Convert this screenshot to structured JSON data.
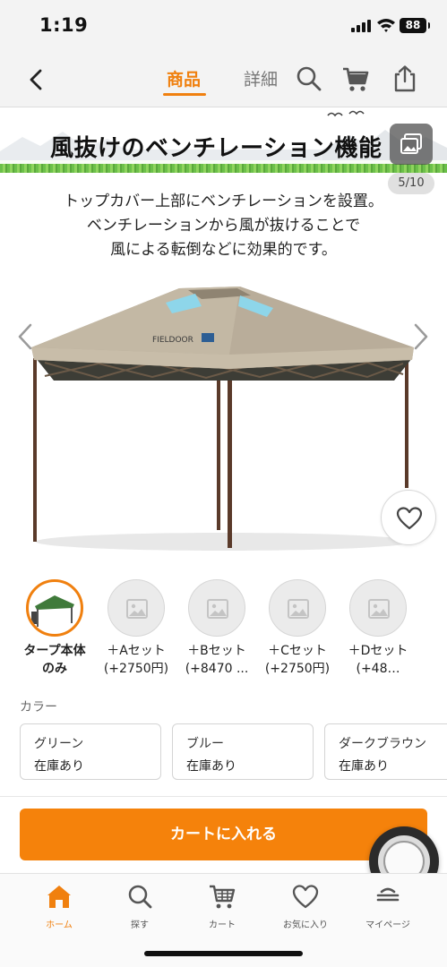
{
  "status_bar": {
    "time": "1:19",
    "battery": "88"
  },
  "nav": {
    "tab_product": "商品",
    "tab_detail": "詳細"
  },
  "gallery": {
    "banner_title": "風抜けのベンチレーション機能",
    "counter": "5/10",
    "description": [
      "トップカバー上部にベンチレーションを設置。",
      "ベンチレーションから風が抜けることで",
      "風による転倒などに効果的です。"
    ],
    "tent_logo": "FIELDOOR"
  },
  "variants": [
    {
      "label_line1": "タープ本体",
      "label_line2": "のみ",
      "selected": true
    },
    {
      "label_line1": "＋Aセット",
      "label_line2": "(+2750円)",
      "selected": false
    },
    {
      "label_line1": "＋Bセット",
      "label_line2": "(+8470 ...",
      "selected": false
    },
    {
      "label_line1": "＋Cセット",
      "label_line2": "(+2750円)",
      "selected": false
    },
    {
      "label_line1": "＋Dセット",
      "label_line2": "(+48…",
      "selected": false
    }
  ],
  "color_section": {
    "label": "カラー",
    "options": [
      {
        "name": "グリーン",
        "stock": "在庫あり"
      },
      {
        "name": "ブルー",
        "stock": "在庫あり"
      },
      {
        "name": "ダークブラウン",
        "stock": "在庫あり"
      }
    ]
  },
  "cart_button": "カートに入れる",
  "tab_bar": [
    {
      "label": "ホーム",
      "icon": "home-icon",
      "active": true
    },
    {
      "label": "探す",
      "icon": "search-icon",
      "active": false
    },
    {
      "label": "カート",
      "icon": "cart-icon",
      "active": false
    },
    {
      "label": "お気に入り",
      "icon": "heart-icon",
      "active": false
    },
    {
      "label": "マイページ",
      "icon": "user-icon",
      "active": false
    }
  ],
  "colors": {
    "accent": "#f0800f",
    "cart_button": "#f5820b"
  }
}
